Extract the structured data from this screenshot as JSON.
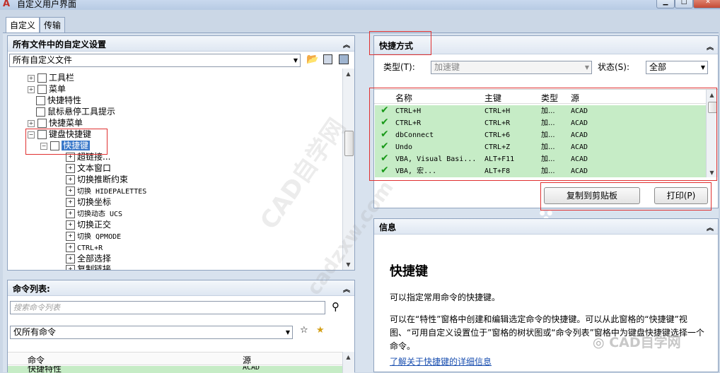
{
  "window": {
    "title": "自定义用户界面"
  },
  "tabs": [
    "自定义",
    "传输"
  ],
  "left_top": {
    "header": "所有文件中的自定义设置",
    "file_select": "所有自定义文件",
    "tree": {
      "toolbar": "工具栏",
      "menu": "菜单",
      "quick_props": "快捷特性",
      "rollover": "鼠标悬停工具提示",
      "shortcut_menu": "快捷菜单",
      "keyboard_shortcuts": "键盘快捷键",
      "shortcut_keys": "快捷键",
      "children": [
        "超链接...",
        "文本窗口",
        "切换推断约束",
        "切换 HIDEPALETTES",
        "切换坐标",
        "切换动态 UCS",
        "切换正交",
        "切换 QPMODE",
        "CTRL+R",
        "全部选择",
        "复制链接"
      ]
    }
  },
  "commands": {
    "header": "命令列表:",
    "search_placeholder": "搜索命令列表",
    "filter": "仅所有命令",
    "col_command": "命令",
    "col_source": "源",
    "first_row": {
      "name": "快捷特性",
      "source": "ACAD"
    }
  },
  "shortcuts": {
    "header": "快捷方式",
    "type_label": "类型(T):",
    "type_value": "加速键",
    "status_label": "状态(S):",
    "status_value": "全部",
    "columns": [
      "名称",
      "主键",
      "类型",
      "源"
    ],
    "rows": [
      {
        "name": "CTRL+H",
        "key": "CTRL+H",
        "type": "加...",
        "source": "ACAD"
      },
      {
        "name": "CTRL+R",
        "key": "CTRL+R",
        "type": "加...",
        "source": "ACAD"
      },
      {
        "name": "dbConnect",
        "key": "CTRL+6",
        "type": "加...",
        "source": "ACAD"
      },
      {
        "name": "Undo",
        "key": "CTRL+Z",
        "type": "加...",
        "source": "ACAD"
      },
      {
        "name": "VBA, Visual Basi...",
        "key": "ALT+F11",
        "type": "加...",
        "source": "ACAD"
      },
      {
        "name": "VBA, 宏...",
        "key": "ALT+F8",
        "type": "加...",
        "source": "ACAD"
      }
    ],
    "copy_button": "复制到剪贴板",
    "print_button": "打印(P)"
  },
  "info": {
    "header": "信息",
    "title": "快捷键",
    "para1": "可以指定常用命令的快捷键。",
    "para2": "可以在“特性”窗格中创建和编辑选定命令的快捷键。可以从此窗格的“快捷键”视图、“可用自定义设置位于”窗格的树状图或“命令列表”窗格中为键盘快捷键选择一个命令。",
    "link": "了解关于快捷键的详细信息"
  },
  "watermark": {
    "site": "CAD自学网",
    "url": "cadzxw.com",
    "badge": "CAD自学网"
  },
  "colors": {
    "selected": "#3a78c9",
    "green_row": "#c6ecc6",
    "annotation_red": "#e03030"
  }
}
